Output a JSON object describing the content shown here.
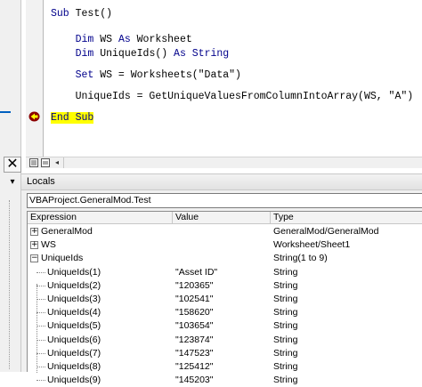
{
  "code": {
    "lines": [
      {
        "parts": [
          {
            "t": "Sub",
            "kw": true
          },
          {
            "t": " Test()"
          }
        ]
      },
      {
        "parts": [
          {
            "t": "    "
          },
          {
            "t": "Dim",
            "kw": true
          },
          {
            "t": " WS "
          },
          {
            "t": "As",
            "kw": true
          },
          {
            "t": " Worksheet"
          }
        ]
      },
      {
        "parts": [
          {
            "t": "    "
          },
          {
            "t": "Dim",
            "kw": true
          },
          {
            "t": " UniqueIds() "
          },
          {
            "t": "As",
            "kw": true
          },
          {
            "t": " "
          },
          {
            "t": "String",
            "kw": true
          }
        ]
      },
      {
        "parts": [
          {
            "t": "    "
          },
          {
            "t": "Set",
            "kw": true
          },
          {
            "t": " WS = Worksheets(\"Data\")"
          }
        ]
      },
      {
        "parts": [
          {
            "t": "    UniqueIds = GetUniqueValuesFromColumnIntoArray(WS, \"A\")"
          }
        ]
      },
      {
        "parts": [
          {
            "t": "End Sub",
            "kw": true
          }
        ],
        "executing": true
      }
    ]
  },
  "locals": {
    "title": "Locals",
    "context": "VBAProject.GeneralMod.Test",
    "columns": [
      "Expression",
      "Value",
      "Type"
    ],
    "rows": [
      {
        "expression": "GeneralMod",
        "value": "",
        "type": "GeneralMod/GeneralMod",
        "level": 0,
        "expander": "+"
      },
      {
        "expression": "WS",
        "value": "",
        "type": "Worksheet/Sheet1",
        "level": 0,
        "expander": "+"
      },
      {
        "expression": "UniqueIds",
        "value": "",
        "type": "String(1 to 9)",
        "level": 0,
        "expander": "-"
      },
      {
        "expression": "UniqueIds(1)",
        "value": "\"Asset ID\"",
        "type": "String",
        "level": 1
      },
      {
        "expression": "UniqueIds(2)",
        "value": "\"120365\"",
        "type": "String",
        "level": 1
      },
      {
        "expression": "UniqueIds(3)",
        "value": "\"102541\"",
        "type": "String",
        "level": 1
      },
      {
        "expression": "UniqueIds(4)",
        "value": "\"158620\"",
        "type": "String",
        "level": 1
      },
      {
        "expression": "UniqueIds(5)",
        "value": "\"103654\"",
        "type": "String",
        "level": 1
      },
      {
        "expression": "UniqueIds(6)",
        "value": "\"123874\"",
        "type": "String",
        "level": 1
      },
      {
        "expression": "UniqueIds(7)",
        "value": "\"147523\"",
        "type": "String",
        "level": 1
      },
      {
        "expression": "UniqueIds(8)",
        "value": "\"125412\"",
        "type": "String",
        "level": 1
      },
      {
        "expression": "UniqueIds(9)",
        "value": "\"145203\"",
        "type": "String",
        "level": 1
      }
    ]
  },
  "ui": {
    "close_glyph": "✕",
    "dropdown_glyph": "▾",
    "scroll_left_glyph": "◂",
    "exec_color": "#ffff00",
    "keyword_color": "#00008b",
    "icons": [
      "close-icon",
      "dropdown-icon",
      "execution-point-icon",
      "full-module-view-icon",
      "procedure-view-icon",
      "scroll-left-icon"
    ]
  }
}
